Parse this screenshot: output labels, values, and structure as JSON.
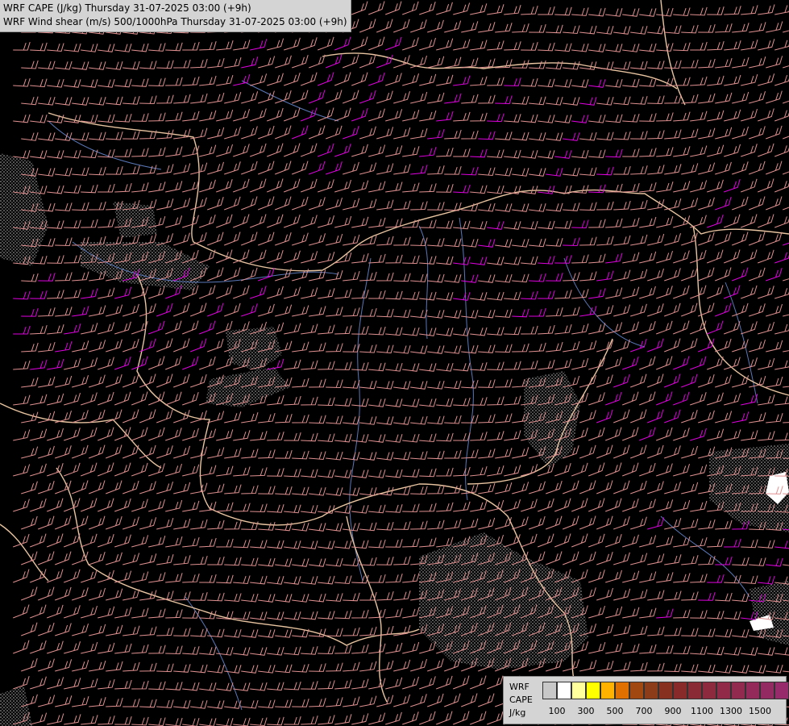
{
  "header": {
    "line1": "WRF CAPE (J/kg) Thursday 31-07-2025 03:00 (+9h)",
    "line2": "WRF Wind shear (m/s) 500/1000hPa Thursday 31-07-2025 03:00 (+9h)"
  },
  "legend": {
    "label_lines": [
      "WRF",
      "CAPE",
      "J/kg"
    ],
    "swatch_colors": [
      "#c8c8c8",
      "#ffffff",
      "#ffff9e",
      "#ffff00",
      "#ffb300",
      "#e07000",
      "#a04810",
      "#8c3c18",
      "#883020",
      "#882a2a",
      "#8a2a34",
      "#8e2a3e",
      "#902a48",
      "#922a50",
      "#942a5a",
      "#942a62",
      "#962a6a"
    ],
    "tick_labels": [
      "100",
      "300",
      "500",
      "700",
      "900",
      "1100",
      "1300",
      "1500"
    ]
  },
  "colors": {
    "background": "#000000",
    "border": "#e8c0a0",
    "river": "#6080c0",
    "barb_normal": "#e09090",
    "barb_strong": "#e000e0",
    "cape_stipple": "#c0c0c0"
  },
  "icons": {
    "barbs": "wind-barb-icon"
  }
}
